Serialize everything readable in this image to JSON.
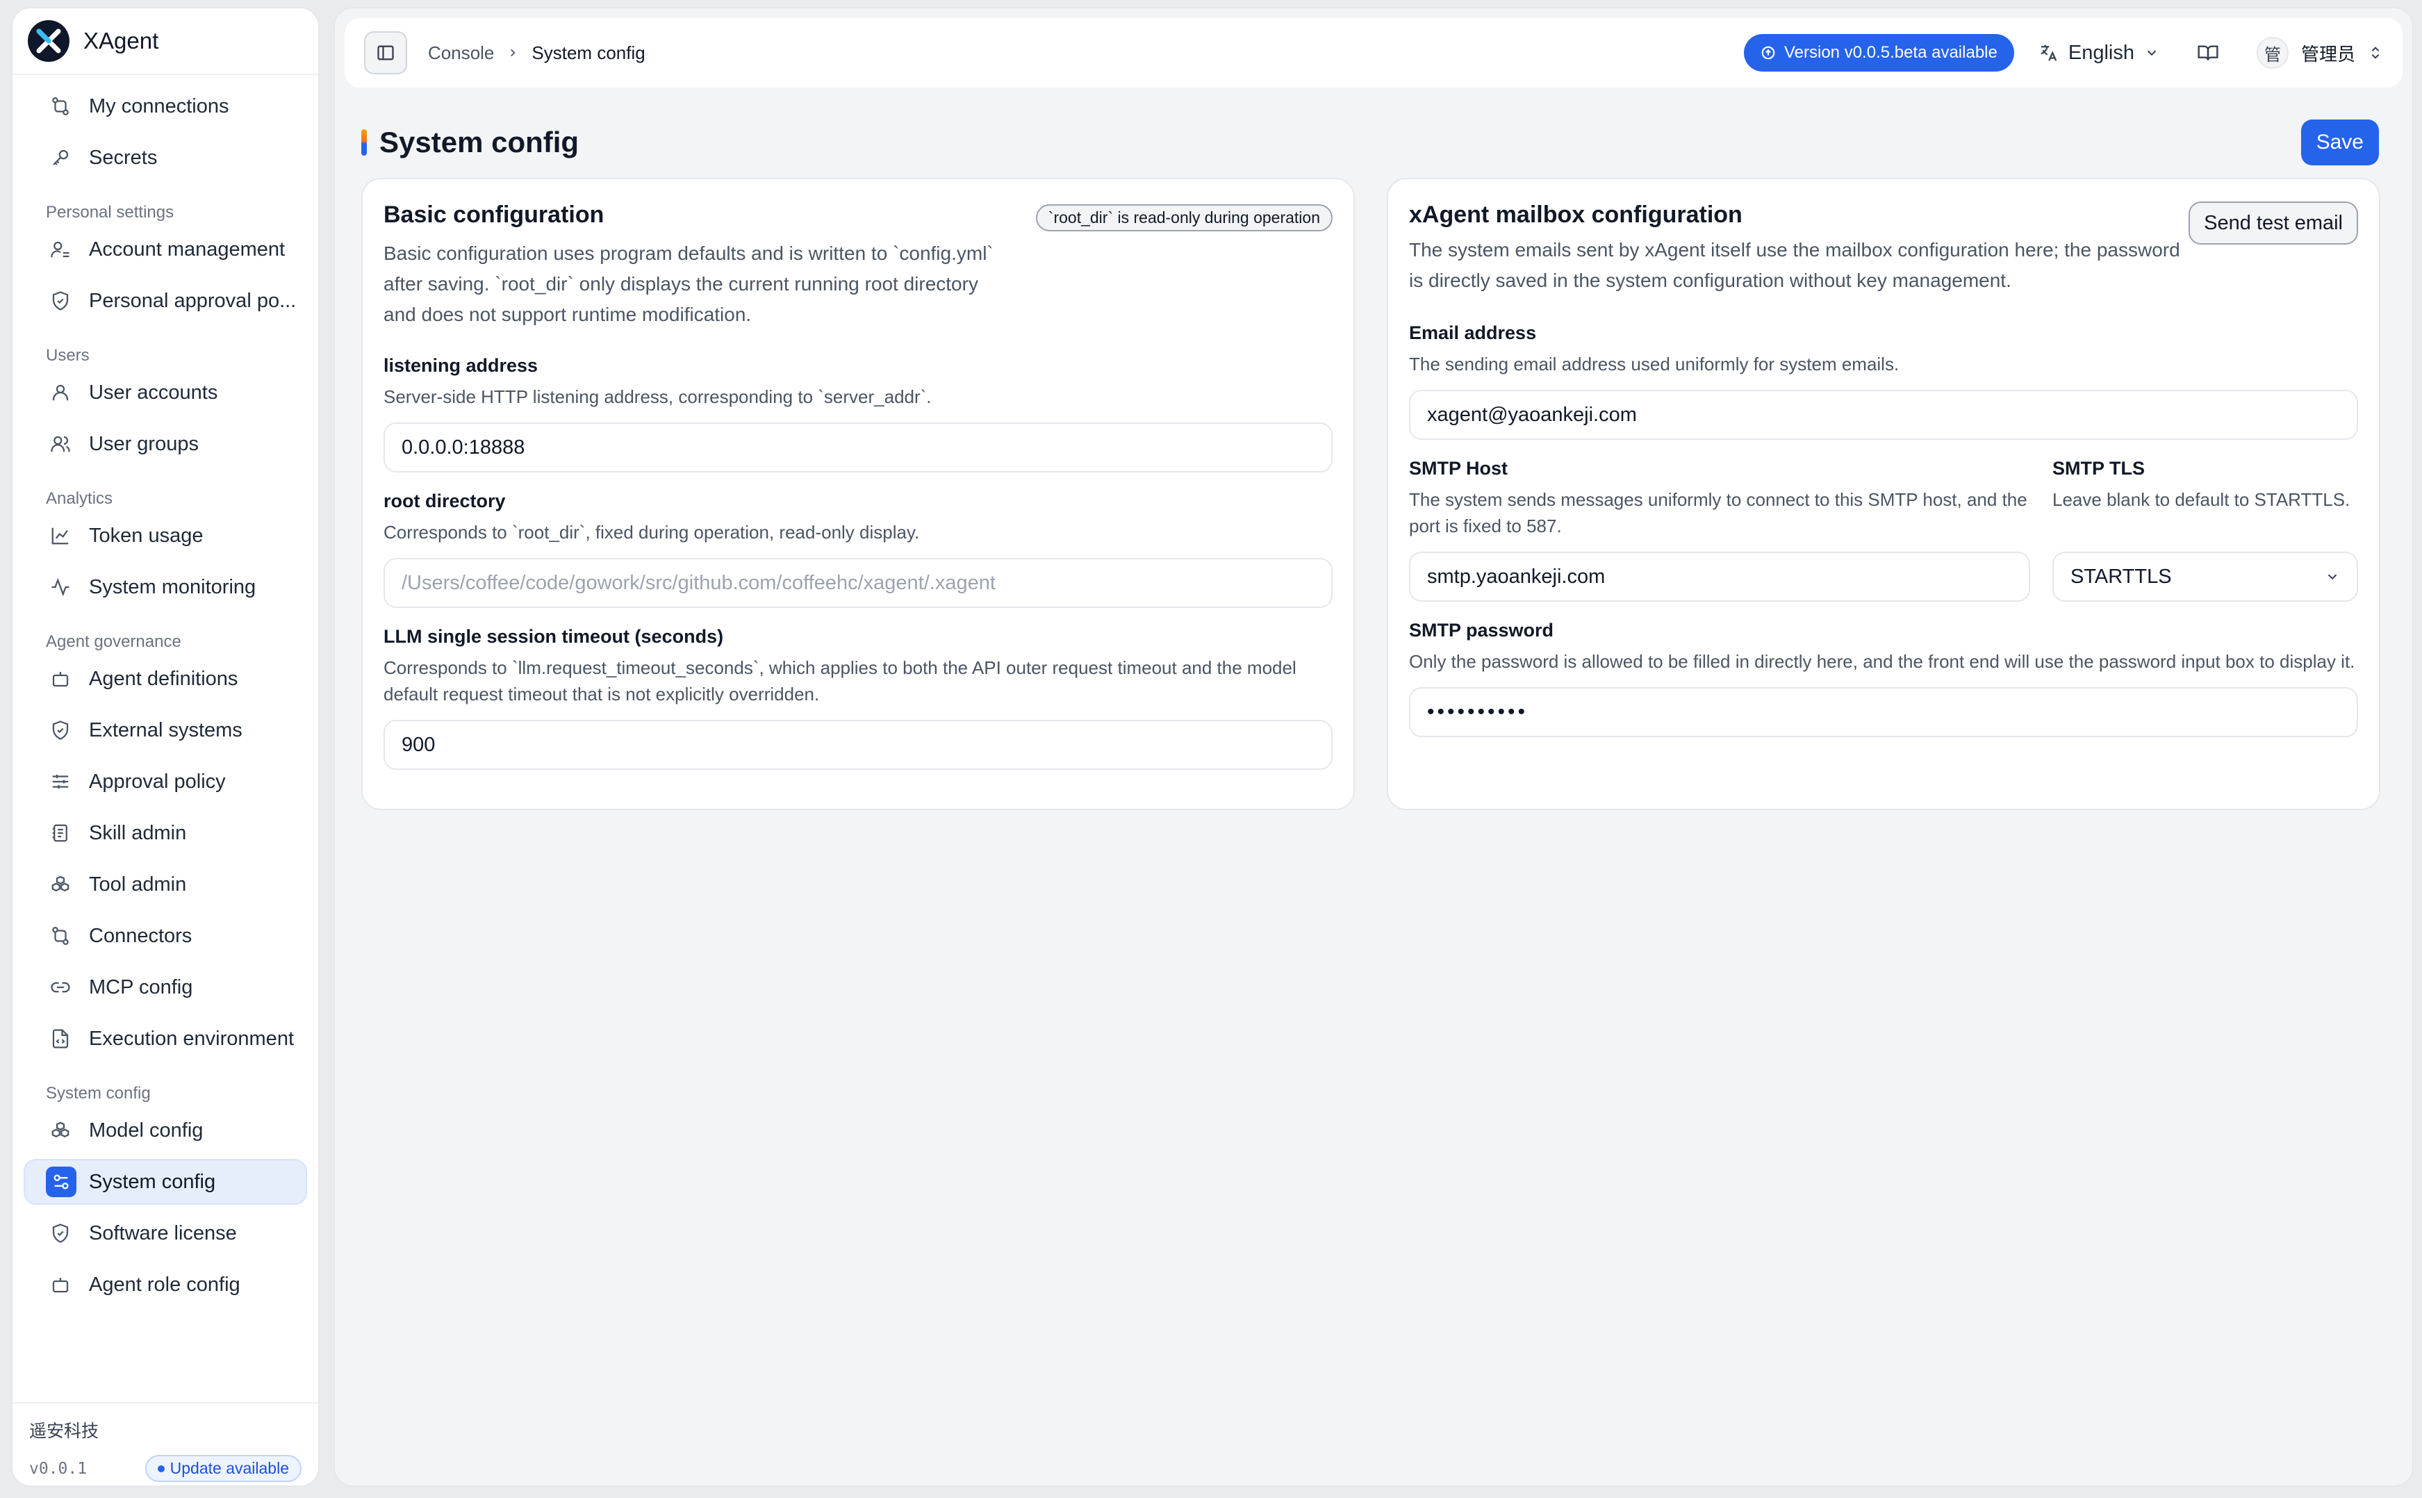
{
  "app": {
    "name": "XAgent"
  },
  "sidebar": {
    "top_items": [
      {
        "label": "My connections",
        "icon": "connections-icon"
      },
      {
        "label": "Secrets",
        "icon": "key-icon"
      }
    ],
    "sections": [
      {
        "title": "Personal settings",
        "items": [
          {
            "label": "Account management",
            "icon": "user-settings-icon"
          },
          {
            "label": "Personal approval po...",
            "icon": "shield-check-icon"
          }
        ]
      },
      {
        "title": "Users",
        "items": [
          {
            "label": "User accounts",
            "icon": "user-icon"
          },
          {
            "label": "User groups",
            "icon": "users-icon"
          }
        ]
      },
      {
        "title": "Analytics",
        "items": [
          {
            "label": "Token usage",
            "icon": "line-chart-icon"
          },
          {
            "label": "System monitoring",
            "icon": "activity-icon"
          }
        ]
      },
      {
        "title": "Agent governance",
        "items": [
          {
            "label": "Agent definitions",
            "icon": "bot-icon"
          },
          {
            "label": "External systems",
            "icon": "shield-icon"
          },
          {
            "label": "Approval policy",
            "icon": "sliders-icon"
          },
          {
            "label": "Skill admin",
            "icon": "notebook-icon"
          },
          {
            "label": "Tool admin",
            "icon": "boxes-icon"
          },
          {
            "label": "Connectors",
            "icon": "connections-icon"
          },
          {
            "label": "MCP config",
            "icon": "link-icon"
          },
          {
            "label": "Execution environment",
            "icon": "file-code-icon"
          }
        ]
      },
      {
        "title": "System config",
        "items": [
          {
            "label": "Model config",
            "icon": "boxes-icon"
          },
          {
            "label": "System config",
            "icon": "settings-toggle-icon",
            "active": true
          },
          {
            "label": "Software license",
            "icon": "shield-icon"
          },
          {
            "label": "Agent role config",
            "icon": "bot-icon"
          }
        ]
      }
    ],
    "footer": {
      "company": "遥安科技",
      "version": "v0.0.1",
      "update_label": "Update available"
    }
  },
  "topbar": {
    "breadcrumb_root": "Console",
    "breadcrumb_current": "System config",
    "version_pill": "Version v0.0.5.beta available",
    "language": "English",
    "user_avatar_char": "管",
    "user_name": "管理员"
  },
  "page": {
    "title": "System config",
    "save_label": "Save"
  },
  "basic": {
    "title": "Basic configuration",
    "badge": "`root_dir` is read-only during operation",
    "desc": "Basic configuration uses program defaults and is written to `config.yml` after saving. `root_dir` only displays the current running root directory and does not support runtime modification.",
    "listen_label": "listening address",
    "listen_desc": "Server-side HTTP listening address, corresponding to `server_addr`.",
    "listen_value": "0.0.0.0:18888",
    "root_label": "root directory",
    "root_desc": "Corresponds to `root_dir`, fixed during operation, read-only display.",
    "root_value": "/Users/coffee/code/gowork/src/github.com/coffeehc/xagent/.xagent",
    "timeout_label": "LLM single session timeout (seconds)",
    "timeout_desc": "Corresponds to `llm.request_timeout_seconds`, which applies to both the API outer request timeout and the model default request timeout that is not explicitly overridden.",
    "timeout_value": "900"
  },
  "mail": {
    "title": "xAgent mailbox configuration",
    "test_label": "Send test email",
    "desc": "The system emails sent by xAgent itself use the mailbox configuration here; the password is directly saved in the system configuration without key management.",
    "email_label": "Email address",
    "email_desc": "The sending email address used uniformly for system emails.",
    "email_value": "xagent@yaoankeji.com",
    "host_label": "SMTP Host",
    "host_desc": "The system sends messages uniformly to connect to this SMTP host, and the port is fixed to 587.",
    "host_value": "smtp.yaoankeji.com",
    "tls_label": "SMTP TLS",
    "tls_desc": "Leave blank to default to STARTTLS.",
    "tls_value": "STARTTLS",
    "pw_label": "SMTP password",
    "pw_desc": "Only the password is allowed to be filled in directly here, and the front end will use the password input box to display it.",
    "pw_value": "••••••••••"
  },
  "colors": {
    "accent": "#2563eb",
    "active_bg": "#e6eefc"
  }
}
